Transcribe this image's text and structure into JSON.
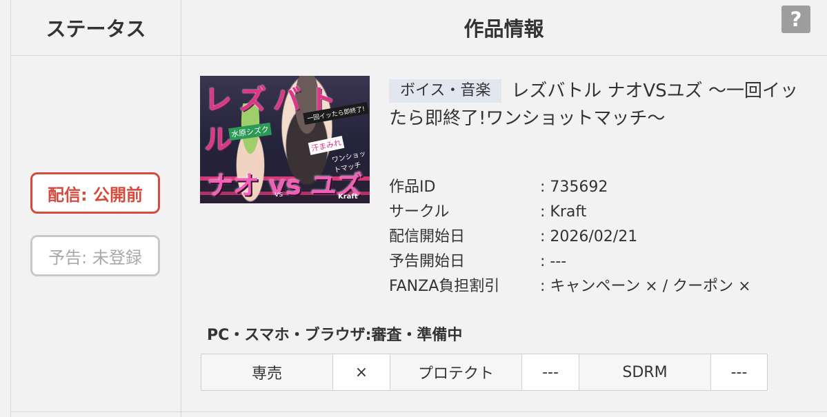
{
  "header": {
    "status_label": "ステータス",
    "info_label": "作品情報",
    "help_label": "?"
  },
  "status": {
    "delivery": "配信: 公開前",
    "preview": "予告: 未登録"
  },
  "thumbnail": {
    "title_art": "レズバトル",
    "subtitle_art": "一回イッたら即終了!",
    "names_art": "ナオ vs ユズ",
    "tag_left": "水原シズク",
    "tag_right": "汗まみれ",
    "tag_match": "ワンショットマッチ",
    "vs_art": "vs",
    "logo_art": "Kraft"
  },
  "product": {
    "category": "ボイス・音楽",
    "title": "レズバトル ナオVSユズ 〜一回イッたら即終了!ワンショットマッチ〜"
  },
  "meta": [
    {
      "key": "作品ID",
      "value": ": 735692"
    },
    {
      "key": "サークル",
      "value": ": Kraft"
    },
    {
      "key": "配信開始日",
      "value": ": 2026/02/21"
    },
    {
      "key": "予告開始日",
      "value": ": ---"
    },
    {
      "key": "FANZA負担割引",
      "value": ": キャンペーン × / クーポン ×"
    }
  ],
  "platform": {
    "label": "PC・スマホ・ブラウザ:審査・準備中"
  },
  "drm": [
    {
      "label": "専売",
      "value": "×"
    },
    {
      "label": "プロテクト",
      "value": "---"
    },
    {
      "label": "SDRM",
      "value": "---"
    }
  ]
}
